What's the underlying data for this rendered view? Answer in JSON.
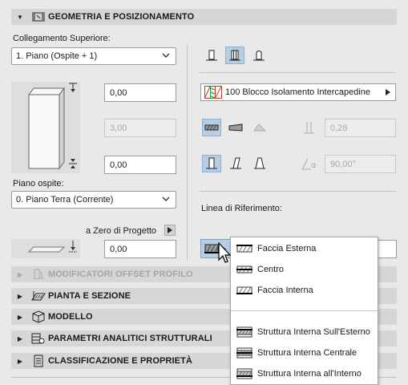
{
  "sections": {
    "geometry": "GEOMETRIA E POSIZIONAMENTO",
    "offset": "MODIFICATORI OFFSET PROFILO",
    "plan": "PIANTA E SEZIONE",
    "model": "MODELLO",
    "analytic": "PARAMETRI ANALITICI STRUTTURALI",
    "classification": "CLASSIFICAZIONE E PROPRIETÀ"
  },
  "left": {
    "top_link_label": "Collegamento Superiore:",
    "top_link_value": "1. Piano (Ospite + 1)",
    "field_top": "0,00",
    "field_height": "3,00",
    "field_bottom": "0,00",
    "home_story_label": "Piano ospite:",
    "home_story_value": "0. Piano Terra (Corrente)",
    "zero_label": "a Zero di Progetto",
    "field_zero": "0,00"
  },
  "right": {
    "composite_value": "100 Blocco Isolamento Intercapedine",
    "thickness": "0,28",
    "angle": "90,00°",
    "ref_line_label": "Linea di Riferimento:"
  },
  "popup": {
    "items": [
      "Faccia Esterna",
      "Centro",
      "Faccia Interna"
    ],
    "core_items": [
      "Struttura Interna Sull'Esterno",
      "Struttura Interna Centrale",
      "Struttura Interna all'Interno"
    ]
  }
}
